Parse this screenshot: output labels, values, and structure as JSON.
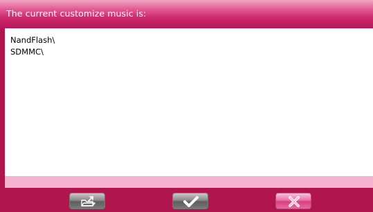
{
  "dialog": {
    "title": "The current customize music is:"
  },
  "paths": [
    "NandFlash\\",
    "SDMMC\\"
  ],
  "toolbar": {
    "buttons": [
      {
        "icon": "folder-export-icon"
      },
      {
        "icon": "checkmark-icon"
      },
      {
        "icon": "close-x-icon"
      }
    ]
  },
  "colors": {
    "frame": "#b0154e",
    "title_gradient_top": "#f2a6c6",
    "title_gradient_bottom": "#b8155a",
    "list_background": "#ffffff",
    "status_strip": "#f5b3d0",
    "confirm_button": "#7a7a7a",
    "cancel_button": "#ec6fa6"
  }
}
